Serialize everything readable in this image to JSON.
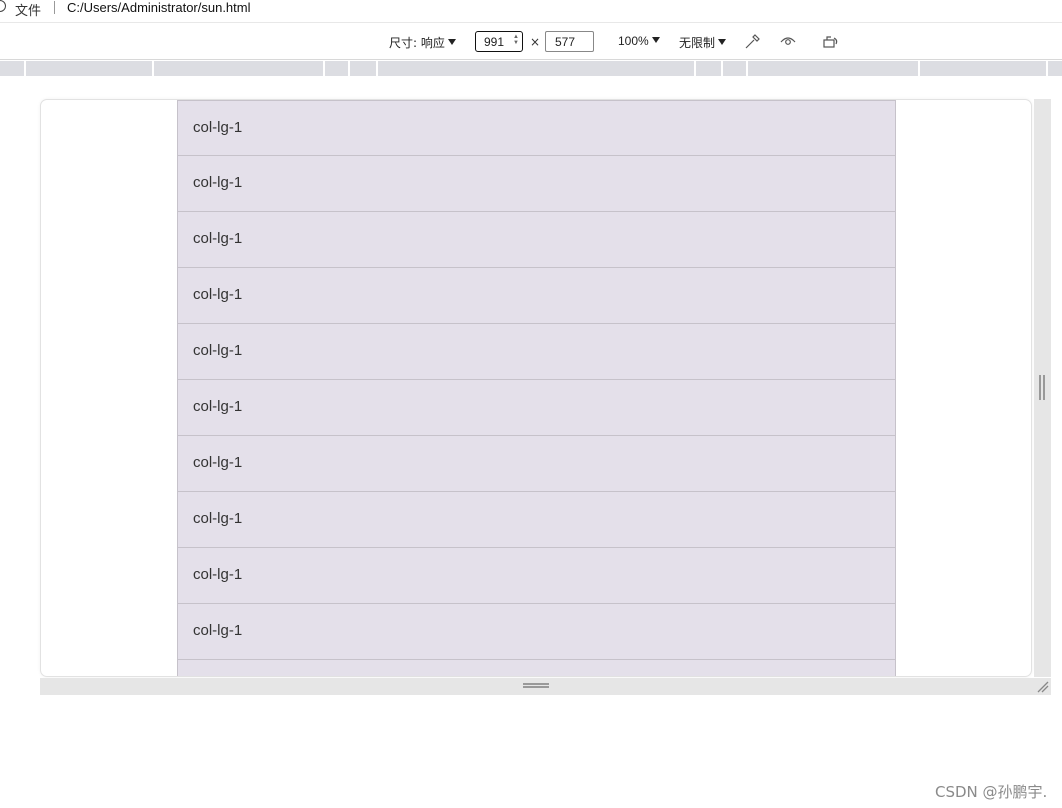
{
  "address_bar": {
    "file_label": "文件",
    "url": "C:/Users/Administrator/sun.html"
  },
  "device_toolbar": {
    "dimensions_label": "尺寸: 响应",
    "width_value": "991",
    "times": "×",
    "height_value": "577",
    "zoom_label": "100%",
    "throttle_label": "无限制",
    "icons": [
      "eyedropper-icon",
      "eye-icon",
      "rotate-icon"
    ]
  },
  "viewport": {
    "columns": [
      {
        "label": "col-lg-1"
      },
      {
        "label": "col-lg-1"
      },
      {
        "label": "col-lg-1"
      },
      {
        "label": "col-lg-1"
      },
      {
        "label": "col-lg-1"
      },
      {
        "label": "col-lg-1"
      },
      {
        "label": "col-lg-1"
      },
      {
        "label": "col-lg-1"
      },
      {
        "label": "col-lg-1"
      },
      {
        "label": "col-lg-1"
      },
      {
        "label": ""
      }
    ]
  },
  "watermark": "CSDN @孙鹏宇.",
  "colors": {
    "column_bg": "#e4e0ea",
    "column_border": "#c6c2ca",
    "ruler_bg": "#dcdde2",
    "handle_bg": "#e6e6e6"
  }
}
